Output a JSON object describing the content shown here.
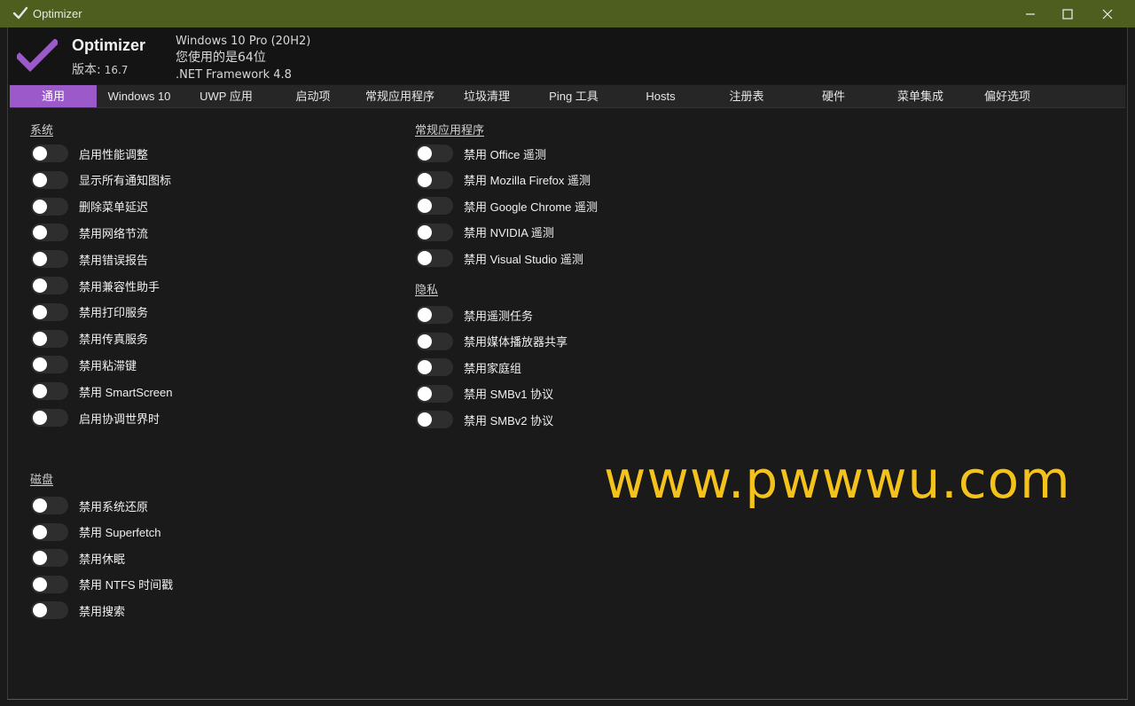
{
  "window": {
    "title": "Optimizer"
  },
  "header": {
    "app_name": "Optimizer",
    "version_label": "版本:",
    "version": "16.7",
    "os": "Windows 10 Pro (20H2)",
    "arch": "您使用的是64位",
    "framework": ".NET Framework 4.8"
  },
  "tabs": [
    {
      "label": "通用"
    },
    {
      "label": "Windows 10"
    },
    {
      "label": "UWP 应用"
    },
    {
      "label": "启动项"
    },
    {
      "label": "常规应用程序"
    },
    {
      "label": "垃圾清理"
    },
    {
      "label": "Ping 工具"
    },
    {
      "label": "Hosts"
    },
    {
      "label": "注册表"
    },
    {
      "label": "硬件"
    },
    {
      "label": "菜单集成"
    },
    {
      "label": "偏好选项"
    }
  ],
  "active_tab": "通用",
  "sections": {
    "system": {
      "title": "系统",
      "items": [
        {
          "label": "启用性能调整",
          "on": false
        },
        {
          "label": "显示所有通知图标",
          "on": false
        },
        {
          "label": "删除菜单延迟",
          "on": false
        },
        {
          "label": "禁用网络节流",
          "on": false
        },
        {
          "label": "禁用错误报告",
          "on": false
        },
        {
          "label": "禁用兼容性助手",
          "on": false
        },
        {
          "label": "禁用打印服务",
          "on": false
        },
        {
          "label": "禁用传真服务",
          "on": false
        },
        {
          "label": "禁用粘滞键",
          "on": false
        },
        {
          "label": "禁用 SmartScreen",
          "on": false
        },
        {
          "label": "启用协调世界时",
          "on": false
        }
      ]
    },
    "disk": {
      "title": "磁盘",
      "items": [
        {
          "label": "禁用系统还原",
          "on": false
        },
        {
          "label": "禁用 Superfetch",
          "on": false
        },
        {
          "label": "禁用休眠",
          "on": false
        },
        {
          "label": "禁用 NTFS 时间戳",
          "on": false
        },
        {
          "label": "禁用搜索",
          "on": false
        }
      ]
    },
    "common_apps": {
      "title": "常规应用程序",
      "items": [
        {
          "label": "禁用 Office 遥测",
          "on": false
        },
        {
          "label": "禁用 Mozilla Firefox 遥测",
          "on": false
        },
        {
          "label": "禁用 Google Chrome 遥测",
          "on": false
        },
        {
          "label": "禁用 NVIDIA 遥测",
          "on": false
        },
        {
          "label": "禁用 Visual Studio 遥测",
          "on": false
        }
      ]
    },
    "privacy": {
      "title": "隐私",
      "items": [
        {
          "label": "禁用遥测任务",
          "on": false
        },
        {
          "label": "禁用媒体播放器共享",
          "on": false
        },
        {
          "label": "禁用家庭组",
          "on": false
        },
        {
          "label": "禁用 SMBv1 协议",
          "on": false
        },
        {
          "label": "禁用 SMBv2 协议",
          "on": false
        }
      ]
    }
  },
  "watermark": "www.pwwwu.com",
  "colors": {
    "titlebar": "#4d5e1f",
    "accent": "#9b59c9",
    "background": "#1a1a1a",
    "watermark": "#f4c21c"
  }
}
